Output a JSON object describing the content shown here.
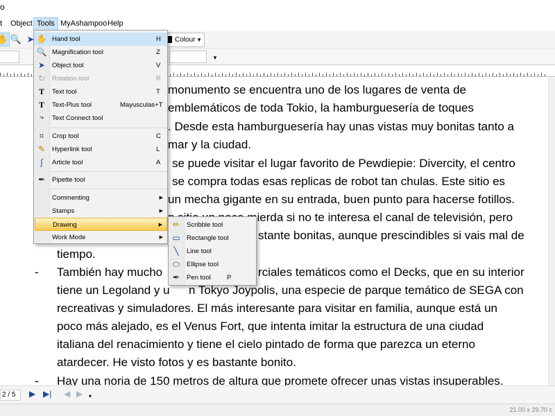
{
  "titlebar": {
    "text": "o"
  },
  "menubar": {
    "items": [
      "t",
      "Object",
      "Tools",
      "MyAshampoo",
      "Help"
    ]
  },
  "toolbar": {
    "colour_label": "Colour"
  },
  "tools_menu": {
    "items": [
      {
        "label": "Hand tool",
        "shortcut": "H",
        "icon": "hand-icon"
      },
      {
        "label": "Magnification tool",
        "shortcut": "Z",
        "icon": "magnifier-icon"
      },
      {
        "label": "Object tool",
        "shortcut": "V",
        "icon": "arrow-pointer-icon"
      },
      {
        "label": "Rotation tool",
        "shortcut": "R",
        "icon": "rotation-icon",
        "disabled": true
      },
      {
        "label": "Text tool",
        "shortcut": "T",
        "icon": "text-icon"
      },
      {
        "label": "Text-Plus tool",
        "shortcut": "Mayusculas+T",
        "icon": "text-plus-icon"
      },
      {
        "label": "Text Connect tool",
        "shortcut": "",
        "icon": "text-connect-icon"
      },
      {
        "label": "Crop tool",
        "shortcut": "C",
        "icon": "crop-icon"
      },
      {
        "label": "Hyperlink tool",
        "shortcut": "L",
        "icon": "hyperlink-icon"
      },
      {
        "label": "Article tool",
        "shortcut": "A",
        "icon": "article-icon"
      },
      {
        "label": "Pipette tool",
        "shortcut": "",
        "icon": "pipette-icon"
      },
      {
        "label": "Commenting",
        "shortcut": "",
        "icon": ""
      },
      {
        "label": "Stamps",
        "shortcut": "",
        "icon": ""
      },
      {
        "label": "Drawing",
        "shortcut": "",
        "icon": ""
      },
      {
        "label": "Work Mode",
        "shortcut": "",
        "icon": ""
      }
    ]
  },
  "drawing_menu": {
    "items": [
      {
        "label": "Scribble tool",
        "shortcut": "",
        "icon": "pencil-icon"
      },
      {
        "label": "Rectangle tool",
        "shortcut": "",
        "icon": "rectangle-icon"
      },
      {
        "label": "Line tool",
        "shortcut": "",
        "icon": "line-icon"
      },
      {
        "label": "Ellipse tool",
        "shortcut": "",
        "icon": "ellipse-icon"
      },
      {
        "label": "Pen tool",
        "shortcut": "P",
        "icon": "pen-icon"
      }
    ]
  },
  "document": {
    "lines": [
      "monumento se encuentra uno de los lugares de venta de",
      "emblemáticos de toda Tokio, la hamburguesería de toques",
      ". Desde esta hamburguesería hay unas vistas muy bonitas tanto a",
      "mar y la ciudad.",
      "se puede visitar el lugar favorito de Pewdiepie: Divercity, el centro",
      "se compra todas esas replicas de robot tan chulas. Este sitio es",
      "un mecha gigante en su entrada, buen punto para hacerse fotillos.",
      "p sitio un poco mierda si no te interesa el canal de televisión, pero",
      "stante bonitas, aunque prescindibles si vais mal de",
      "tiempo.",
      "También hay mucho",
      "rciales temáticos como el Decks, que en su interior",
      "tiene un Legoland y u",
      "n Tokyo Joypolis, una especie de parque temático de SEGA con",
      "recreativas y simuladores. El más interesante para visitar en familia, aunque está un",
      "poco más alejado, es el Venus Fort, que intenta imitar la estructura de una ciudad",
      "italiana del renacimiento y tiene el cielo pintado de forma que parezca un eterno",
      "atardecer. He visto fotos y es bastante bonito.",
      "Hay una noria de 150 metros de altura que promete ofrecer unas vistas insuperables."
    ],
    "bullets": [
      "-",
      "-"
    ]
  },
  "navbar": {
    "page": "2 / 5"
  },
  "statusbar": {
    "page_size": "21.00 x 29.70 c"
  }
}
